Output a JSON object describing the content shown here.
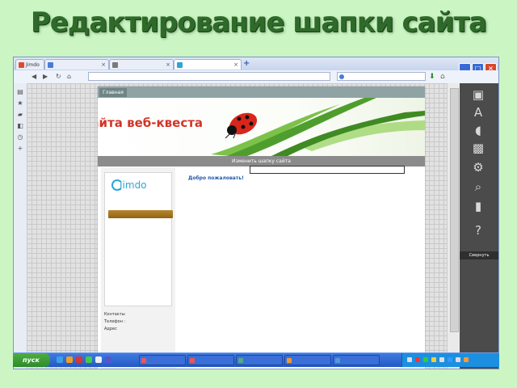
{
  "slide": {
    "title": "Редактирование шапки сайта"
  },
  "browser": {
    "tabs": [
      {
        "label": "Jimdo"
      },
      {
        "label": ""
      },
      {
        "label": ""
      },
      {
        "label": ""
      }
    ],
    "address": "",
    "search_placeholder": ""
  },
  "site": {
    "menu_home": "Главная",
    "header_title": "Шапка сайта веб-квеста",
    "edit_header_label": "Изменить шапку сайта",
    "welcome": "Добро пожаловать!",
    "free_button": "",
    "footer_links": "",
    "footer_right": "",
    "contacts": [
      "Контакты",
      "Телефон :",
      "Адрес"
    ]
  },
  "editor": {
    "collapse_label": "Свернуть"
  },
  "taskbar": {
    "start_label": "пуск",
    "tasks": [
      "",
      "",
      "",
      "",
      "",
      ""
    ]
  },
  "colors": {
    "slide_bg": "#ccf5c4",
    "title_green": "#2f6a2a",
    "header_red": "#d23426",
    "jimdo_blue": "#2aa7d8"
  }
}
